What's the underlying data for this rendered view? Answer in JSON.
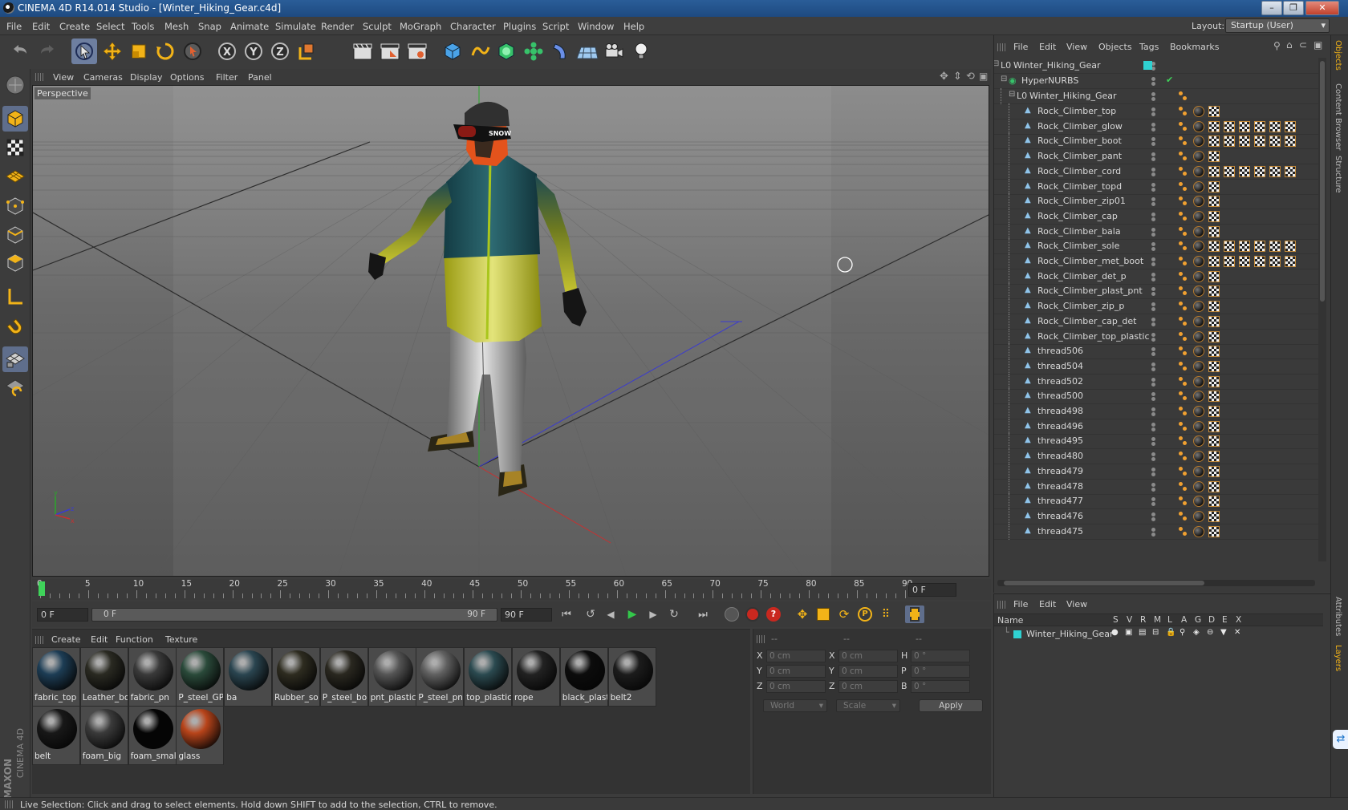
{
  "window": {
    "title": "CINEMA 4D R14.014 Studio - [Winter_Hiking_Gear.c4d]"
  },
  "menubar": {
    "items": [
      "File",
      "Edit",
      "Create",
      "Select",
      "Tools",
      "Mesh",
      "Snap",
      "Animate",
      "Simulate",
      "Render",
      "Sculpt",
      "MoGraph",
      "Character",
      "Plugins",
      "Script",
      "Window",
      "Help"
    ],
    "layout_label": "Layout:",
    "layout_value": "Startup (User)"
  },
  "viewport": {
    "menu": [
      "View",
      "Cameras",
      "Display",
      "Options",
      "Filter",
      "Panel"
    ],
    "label": "Perspective",
    "goggle_text": "SNOW"
  },
  "timeline": {
    "ticks": [
      "0",
      "5",
      "10",
      "15",
      "20",
      "25",
      "30",
      "35",
      "40",
      "45",
      "50",
      "55",
      "60",
      "65",
      "70",
      "75",
      "80",
      "85",
      "90"
    ],
    "current_frame": "0 F"
  },
  "transport": {
    "start_frame": "0 F",
    "range_start": "0 F",
    "range_end": "90 F",
    "end_frame": "90 F"
  },
  "materials": {
    "menu": [
      "Create",
      "Edit",
      "Function",
      "Texture"
    ],
    "items": [
      {
        "label": "fabric_top",
        "color": "#1d3d55"
      },
      {
        "label": "Leather_bo",
        "color": "#2a2a22"
      },
      {
        "label": "fabric_pn",
        "color": "#3a3a3a"
      },
      {
        "label": "P_steel_GP",
        "color": "#2a4a3a"
      },
      {
        "label": "ba",
        "color": "#2a4550"
      },
      {
        "label": "Rubber_so",
        "color": "#2e2c20"
      },
      {
        "label": "P_steel_boi",
        "color": "#2a2820"
      },
      {
        "label": "pnt_plastic",
        "color": "#555555"
      },
      {
        "label": "P_steel_pnt",
        "color": "#606060"
      },
      {
        "label": "top_plastic",
        "color": "#2b4a50"
      },
      {
        "label": "rope",
        "color": "#222222"
      },
      {
        "label": "black_plast",
        "color": "#0c0c0c"
      },
      {
        "label": "belt2",
        "color": "#1c1c1c"
      },
      {
        "label": "belt",
        "color": "#181818"
      },
      {
        "label": "foam_big",
        "color": "#3a3a3a"
      },
      {
        "label": "foam_small",
        "color": "#050505"
      },
      {
        "label": "glass",
        "color": "#b8441a"
      }
    ]
  },
  "coords": {
    "headers": [
      "--",
      "--",
      "--"
    ],
    "rows": [
      {
        "a": "X",
        "av": "0 cm",
        "b": "X",
        "bv": "0 cm",
        "c": "H",
        "cv": "0 °"
      },
      {
        "a": "Y",
        "av": "0 cm",
        "b": "Y",
        "bv": "0 cm",
        "c": "P",
        "cv": "0 °"
      },
      {
        "a": "Z",
        "av": "0 cm",
        "b": "Z",
        "bv": "0 cm",
        "c": "B",
        "cv": "0 °"
      }
    ],
    "mode1": "World",
    "mode2": "Scale",
    "apply": "Apply"
  },
  "objects": {
    "menu": [
      "File",
      "Edit",
      "View",
      "Objects",
      "Tags",
      "Bookmarks"
    ],
    "root": "Winter_Hiking_Gear",
    "hypernurbs": "HyperNURBS",
    "group": "Winter_Hiking_Gear",
    "children": [
      {
        "name": "Rock_Climber_top",
        "tags": 1
      },
      {
        "name": "Rock_Climber_glow",
        "tags": 6
      },
      {
        "name": "Rock_Climber_boot",
        "tags": 6
      },
      {
        "name": "Rock_Climber_pant",
        "tags": 1
      },
      {
        "name": "Rock_Climber_cord",
        "tags": 6
      },
      {
        "name": "Rock_Climber_topd",
        "tags": 1
      },
      {
        "name": "Rock_Climber_zip01",
        "tags": 1
      },
      {
        "name": "Rock_Climber_cap",
        "tags": 1
      },
      {
        "name": "Rock_Climber_bala",
        "tags": 1
      },
      {
        "name": "Rock_Climber_sole",
        "tags": 6
      },
      {
        "name": "Rock_Climber_met_boot",
        "tags": 6
      },
      {
        "name": "Rock_Climber_det_p",
        "tags": 1
      },
      {
        "name": "Rock_Climber_plast_pnt",
        "tags": 1
      },
      {
        "name": "Rock_Climber_zip_p",
        "tags": 1
      },
      {
        "name": "Rock_Climber_cap_det",
        "tags": 1
      },
      {
        "name": "Rock_Climber_top_plastic",
        "tags": 1
      },
      {
        "name": "thread506",
        "tags": 1
      },
      {
        "name": "thread504",
        "tags": 1
      },
      {
        "name": "thread502",
        "tags": 1
      },
      {
        "name": "thread500",
        "tags": 1
      },
      {
        "name": "thread498",
        "tags": 1
      },
      {
        "name": "thread496",
        "tags": 1
      },
      {
        "name": "thread495",
        "tags": 1
      },
      {
        "name": "thread480",
        "tags": 1
      },
      {
        "name": "thread479",
        "tags": 1
      },
      {
        "name": "thread478",
        "tags": 1
      },
      {
        "name": "thread477",
        "tags": 1
      },
      {
        "name": "thread476",
        "tags": 1
      },
      {
        "name": "thread475",
        "tags": 1
      }
    ]
  },
  "layers": {
    "menu": [
      "File",
      "Edit",
      "View"
    ],
    "col_name": "Name",
    "cols": [
      "S",
      "V",
      "R",
      "M",
      "L",
      "A",
      "G",
      "D",
      "E",
      "X"
    ],
    "row": "Winter_Hiking_Gear"
  },
  "right_tabs": [
    "Objects",
    "Content Browser",
    "Structure",
    "Attributes",
    "Layers"
  ],
  "brand": {
    "maxon": "MAXON",
    "cinema": "CINEMA 4D"
  },
  "status": "Live Selection: Click and drag to select elements. Hold down SHIFT to add to the selection, CTRL to remove.",
  "colors": {
    "accent": "#6e7fa0",
    "teal": "#2fd1d1",
    "orange": "#f0a030"
  }
}
